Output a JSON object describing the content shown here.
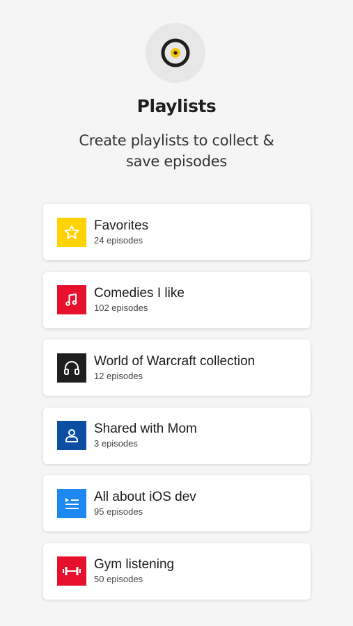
{
  "header": {
    "icon": "vinyl-record-icon",
    "title": "Playlists",
    "subtitle_line1": "Create playlists to collect &",
    "subtitle_line2": "save episodes"
  },
  "playlists": [
    {
      "name": "Favorites",
      "count": "24 episodes",
      "icon": "star-icon",
      "color": "#ffd200"
    },
    {
      "name": "Comedies I like",
      "count": "102 episodes",
      "icon": "music-note-icon",
      "color": "#e8112d"
    },
    {
      "name": "World of Warcraft collection",
      "count": "12 episodes",
      "icon": "headphones-icon",
      "color": "#1f1f1f"
    },
    {
      "name": "Shared with Mom",
      "count": "3 episodes",
      "icon": "person-icon",
      "color": "#0b4ea2"
    },
    {
      "name": "All about iOS dev",
      "count": "95 episodes",
      "icon": "playlist-icon",
      "color": "#1e88f2"
    },
    {
      "name": "Gym listening",
      "count": "50 episodes",
      "icon": "dumbbell-icon",
      "color": "#e8112d"
    }
  ]
}
